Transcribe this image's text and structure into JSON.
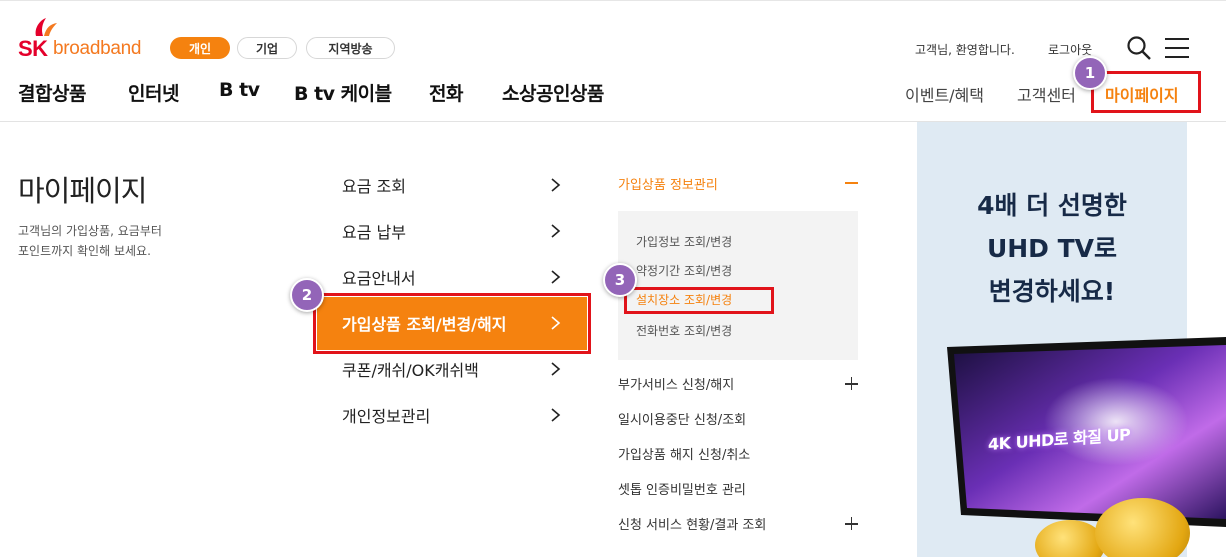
{
  "brand": {
    "sk": "SK",
    "name": "broadband"
  },
  "segments": [
    {
      "label": "개인",
      "active": true
    },
    {
      "label": "기업",
      "active": false
    },
    {
      "label": "지역방송",
      "active": false
    }
  ],
  "header": {
    "welcome": "고객님, 환영합니다.",
    "logout": "로그아웃",
    "search_icon": "search-icon",
    "menu_icon": "hamburger-menu-icon"
  },
  "gnb": [
    "결합상품",
    "인터넷",
    "B tv",
    "B tv 케이블",
    "전화",
    "소상공인상품"
  ],
  "util_nav": [
    "이벤트/혜택",
    "고객센터",
    "마이페이지"
  ],
  "badges": [
    "1",
    "2",
    "3"
  ],
  "page": {
    "title": "마이페이지",
    "desc_line1": "고객님의 가입상품, 요금부터",
    "desc_line2": "포인트까지 확인해 보세요."
  },
  "menu_level1": [
    {
      "label": "요금 조회"
    },
    {
      "label": "요금 납부"
    },
    {
      "label": "요금안내서"
    },
    {
      "label": "가입상품 조회/변경/해지",
      "active": true
    },
    {
      "label": "쿠폰/캐쉬/OK캐쉬백"
    },
    {
      "label": "개인정보관리"
    }
  ],
  "menu_level2": {
    "title": "가입상품 정보관리",
    "children": [
      {
        "label": "가입정보 조회/변경"
      },
      {
        "label": "약정기간 조회/변경"
      },
      {
        "label": "설치장소 조회/변경",
        "active": true
      },
      {
        "label": "전화번호 조회/변경"
      }
    ],
    "items": [
      {
        "label": "부가서비스 신청/해지",
        "expandable": true
      },
      {
        "label": "일시이용중단 신청/조회"
      },
      {
        "label": "가입상품 해지 신청/취소"
      },
      {
        "label": "셋톱 인증비밀번호 관리"
      },
      {
        "label": "신청 서비스 현황/결과 조회",
        "expandable": true
      }
    ]
  },
  "banner": {
    "line1": "4배 더 선명한",
    "line2": "UHD TV로",
    "line3": "변경하세요!",
    "tv_text": "4K UHD로 화질 UP"
  },
  "colors": {
    "accent": "#f5820f",
    "highlight": "#e1131a",
    "badge": "#9365b8",
    "brand_red": "#e4002b"
  }
}
